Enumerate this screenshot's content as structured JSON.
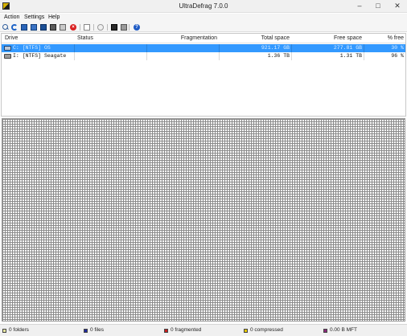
{
  "window": {
    "title": "UltraDefrag 7.0.0"
  },
  "menu": {
    "items": [
      "Action",
      "Settings",
      "Help"
    ]
  },
  "list": {
    "columns": [
      "Drive",
      "Status",
      "Fragmentation",
      "Total space",
      "Free space",
      "% free"
    ],
    "rows": [
      {
        "drive": "C: [NTFS]  OS",
        "status": "",
        "fragmentation": "",
        "total_space": "921.17 GB",
        "free_space": "277.81 GB",
        "pct_free": "30 %",
        "selected": true
      },
      {
        "drive": "I: [NTFS]  Seagate",
        "status": "",
        "fragmentation": "",
        "total_space": "1.36 TB",
        "free_space": "1.31 TB",
        "pct_free": "96 %",
        "selected": false
      }
    ]
  },
  "status": {
    "folders": "0 folders",
    "files": "0 files",
    "fragmented": "0 fragmented",
    "compressed": "0 compressed",
    "mft": "0.00 B MFT"
  },
  "colors": {
    "selection": "#3399ff",
    "folders": "#e6e6a0",
    "files": "#1f2a9c",
    "fragmented": "#c81e1e",
    "compressed": "#e6c800",
    "mft": "#8a2a7a"
  },
  "icons": [
    "app-icon",
    "analyze-icon",
    "repeat-icon",
    "defragment-icon",
    "quick-optimize-icon",
    "full-optimize-icon",
    "optimize-mft-icon",
    "mft-icon",
    "stop-icon",
    "report-icon",
    "schedule-icon",
    "boot-time-icon",
    "preferences-icon",
    "help-icon"
  ]
}
